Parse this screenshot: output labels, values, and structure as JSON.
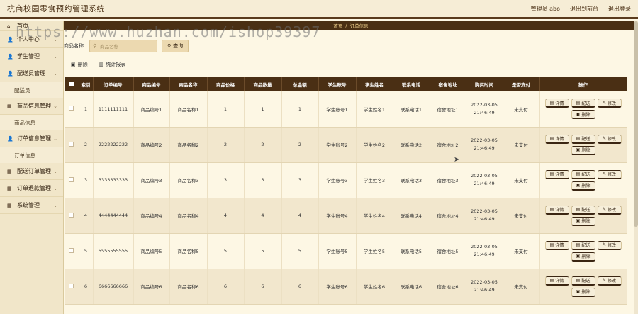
{
  "app": {
    "title": "杭商校园零食预约管理系统",
    "top_links": [
      "管理员 abo",
      "退出到前台",
      "退出登录"
    ]
  },
  "sidebar": {
    "items": [
      {
        "label": "首页",
        "icon": "home-icon",
        "sub": []
      },
      {
        "label": "个人中心",
        "icon": "user-icon",
        "sub": []
      },
      {
        "label": "学生管理",
        "icon": "user-icon",
        "sub": []
      },
      {
        "label": "配送员管理",
        "icon": "user-icon",
        "sub": [
          "配送员"
        ]
      },
      {
        "label": "商品信息管理",
        "icon": "grid-icon",
        "sub": [
          "商品信息"
        ]
      },
      {
        "label": "订单信息管理",
        "icon": "user-icon",
        "sub": [
          "订单信息"
        ]
      },
      {
        "label": "配送订单管理",
        "icon": "grid-icon",
        "sub": []
      },
      {
        "label": "订单退款管理",
        "icon": "grid-icon",
        "sub": []
      },
      {
        "label": "系统管理",
        "icon": "grid-icon",
        "sub": []
      }
    ]
  },
  "breadcrumb": {
    "home": "首页",
    "current": "订单信息"
  },
  "search": {
    "label": "商品名称",
    "placeholder": "商品名称",
    "button": "查询"
  },
  "actions": {
    "delete": "删除",
    "stats": "统计报表"
  },
  "table": {
    "headers": [
      "索引",
      "订单编号",
      "商品编号",
      "商品名称",
      "商品价格",
      "商品数量",
      "总金额",
      "学生账号",
      "学生姓名",
      "联系电话",
      "宿舍地址",
      "购买时间",
      "是否支付",
      "操作"
    ],
    "rows": [
      {
        "index": "1",
        "order_no": "1111111111",
        "goods_no": "商品编号1",
        "goods_name": "商品名称1",
        "price": "1",
        "qty": "1",
        "total": "1",
        "student_acct": "学生账号1",
        "student_name": "学生姓名1",
        "phone": "联系电话1",
        "address": "宿舍地址1",
        "time": "2022-03-05 21:46:49",
        "paid": "未支付"
      },
      {
        "index": "2",
        "order_no": "2222222222",
        "goods_no": "商品编号2",
        "goods_name": "商品名称2",
        "price": "2",
        "qty": "2",
        "total": "2",
        "student_acct": "学生账号2",
        "student_name": "学生姓名2",
        "phone": "联系电话2",
        "address": "宿舍地址2",
        "time": "2022-03-05 21:46:49",
        "paid": "未支付"
      },
      {
        "index": "3",
        "order_no": "3333333333",
        "goods_no": "商品编号3",
        "goods_name": "商品名称3",
        "price": "3",
        "qty": "3",
        "total": "3",
        "student_acct": "学生账号3",
        "student_name": "学生姓名3",
        "phone": "联系电话3",
        "address": "宿舍地址3",
        "time": "2022-03-05 21:46:49",
        "paid": "未支付"
      },
      {
        "index": "4",
        "order_no": "4444444444",
        "goods_no": "商品编号4",
        "goods_name": "商品名称4",
        "price": "4",
        "qty": "4",
        "total": "4",
        "student_acct": "学生账号4",
        "student_name": "学生姓名4",
        "phone": "联系电话4",
        "address": "宿舍地址4",
        "time": "2022-03-05 21:46:49",
        "paid": "未支付"
      },
      {
        "index": "5",
        "order_no": "5555555555",
        "goods_no": "商品编号5",
        "goods_name": "商品名称5",
        "price": "5",
        "qty": "5",
        "total": "5",
        "student_acct": "学生账号5",
        "student_name": "学生姓名5",
        "phone": "联系电话5",
        "address": "宿舍地址5",
        "time": "2022-03-05 21:46:49",
        "paid": "未支付"
      },
      {
        "index": "6",
        "order_no": "6666666666",
        "goods_no": "商品编号6",
        "goods_name": "商品名称6",
        "price": "6",
        "qty": "6",
        "total": "6",
        "student_acct": "学生账号6",
        "student_name": "学生姓名6",
        "phone": "联系电话6",
        "address": "宿舍地址6",
        "time": "2022-03-05 21:46:49",
        "paid": "未支付"
      }
    ],
    "op_buttons": {
      "detail": "详情",
      "dispatch": "配送",
      "edit": "修改",
      "delete": "删除"
    }
  },
  "watermark": "https://www.huzhan.com/ishop39397"
}
